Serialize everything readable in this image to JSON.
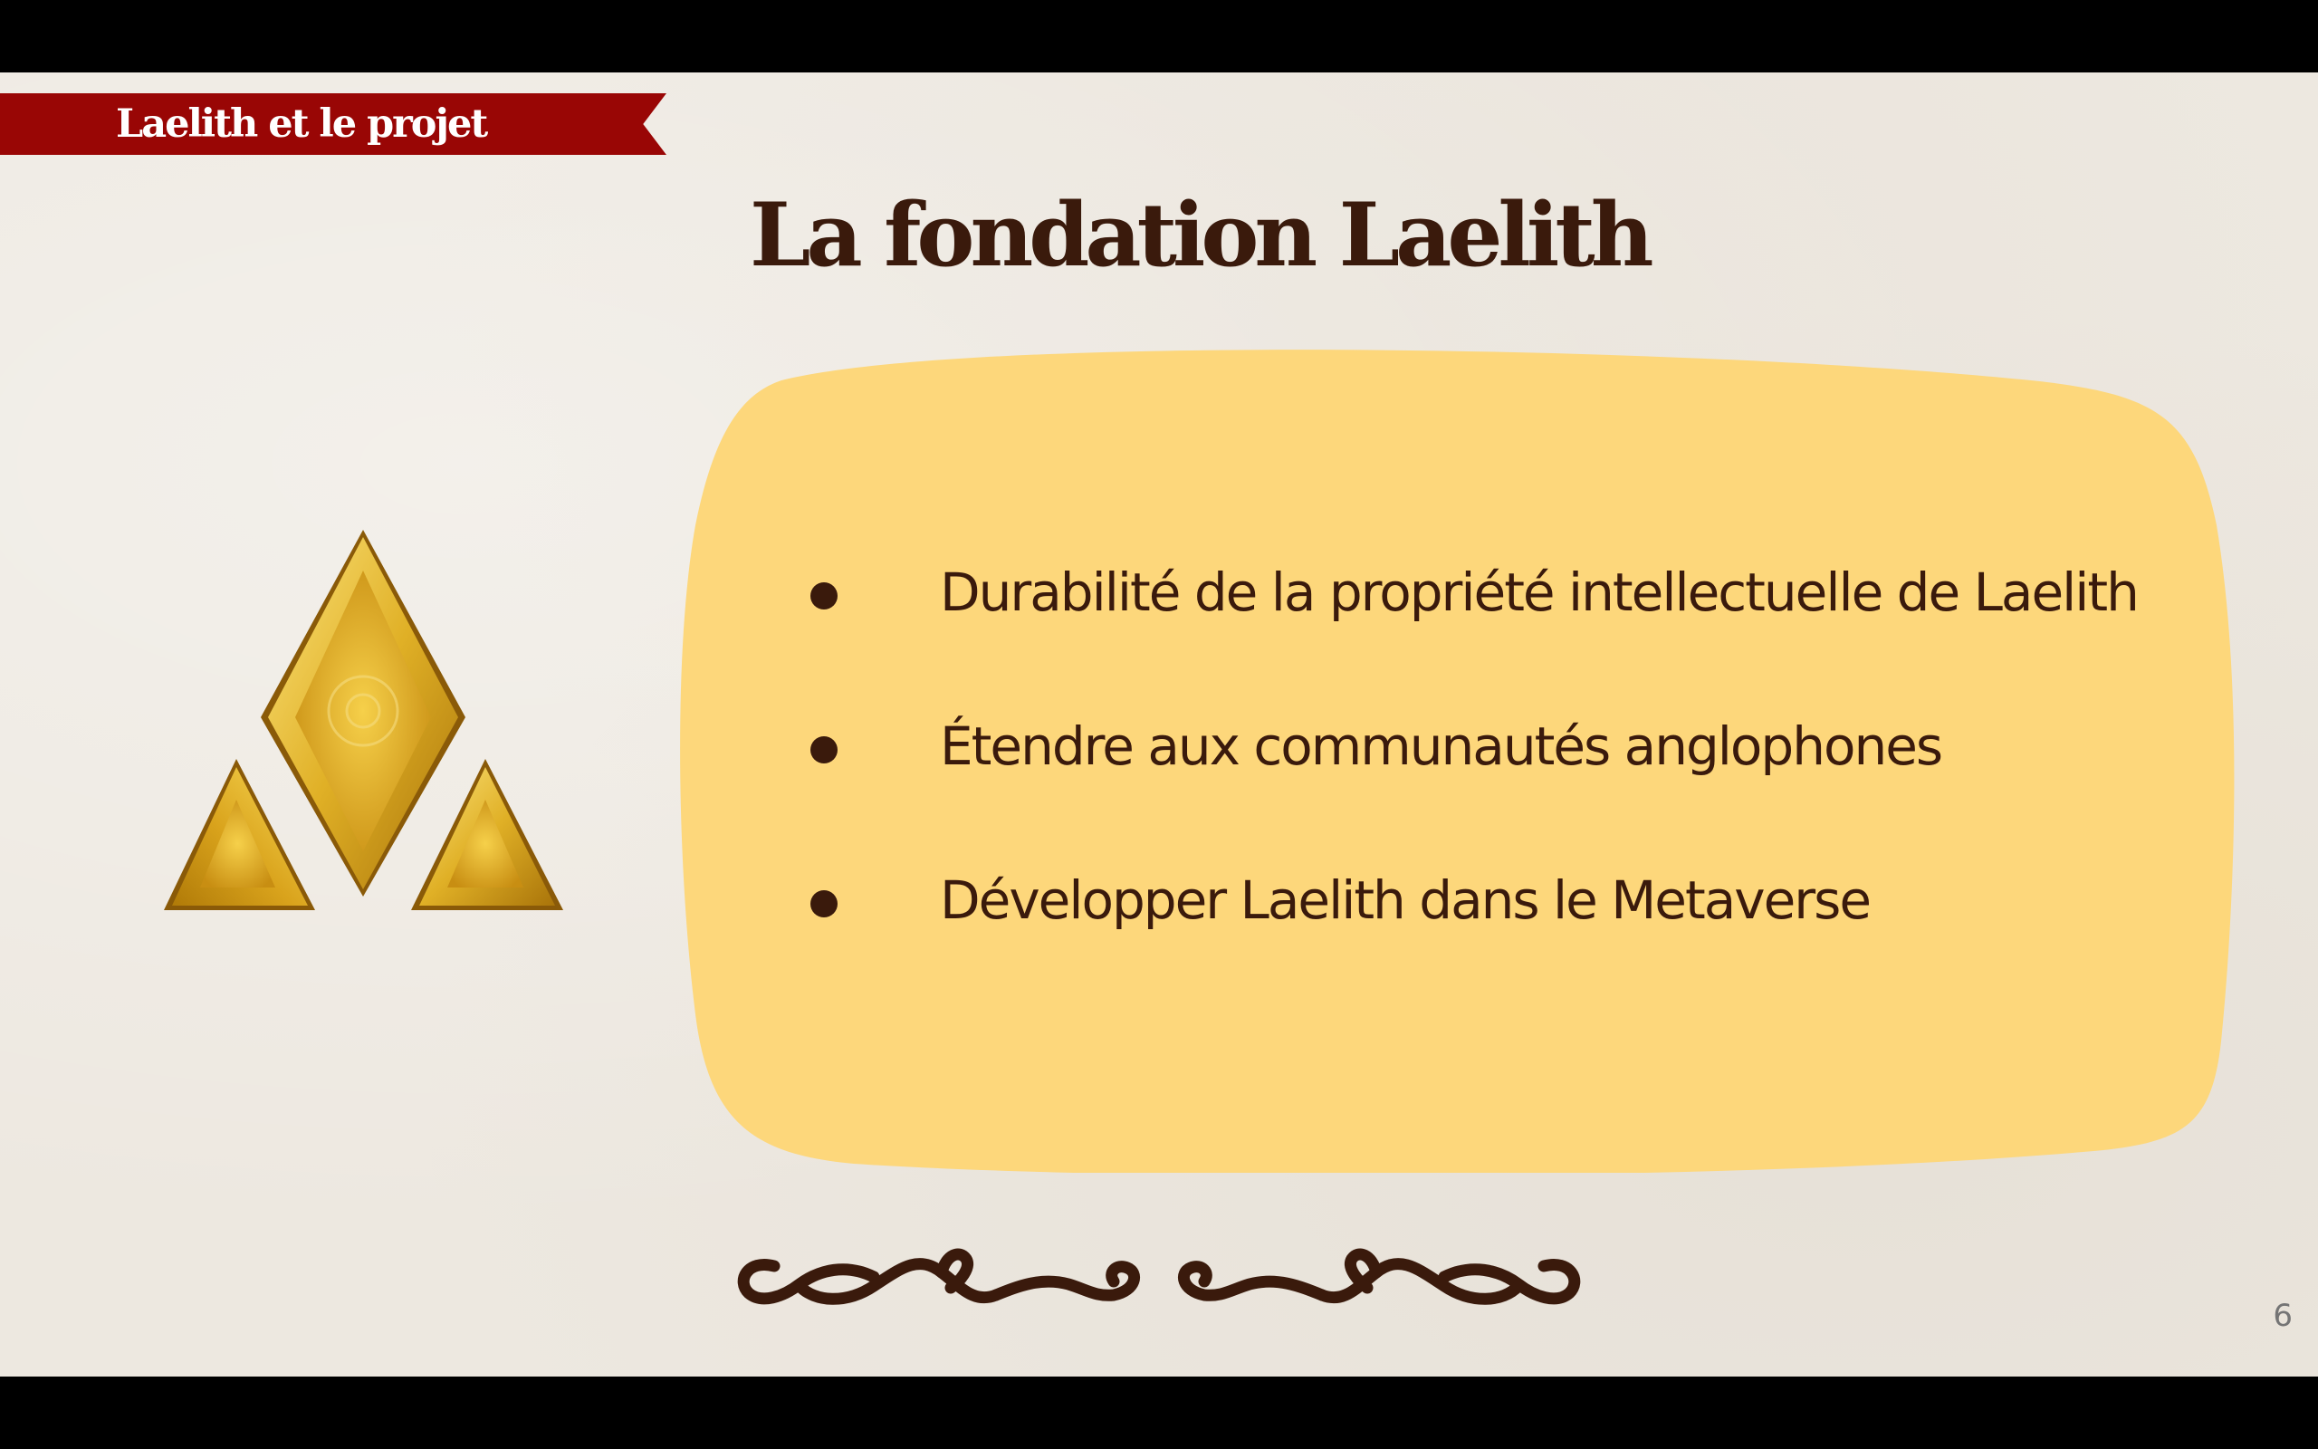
{
  "slide": {
    "section_label": "Laelith et le projet",
    "title": "La fondation Laelith",
    "bullets": [
      "Durabilité de la propriété intellectuelle de Laelith",
      "Étendre aux communautés anglophones",
      "Développer Laelith dans le Metaverse"
    ],
    "page_number": "6"
  },
  "icons": {
    "logo": "golden-triangle-gems-icon",
    "ornament": "swirl-flourish-icon",
    "bullet": "bullet-dot-icon"
  },
  "colors": {
    "background": "#ede8e0",
    "banner": "#990605",
    "title_text": "#3a1a0c",
    "panel": "#fdd77b",
    "gold_light": "#f7d450",
    "gold_dark": "#a9740a"
  }
}
